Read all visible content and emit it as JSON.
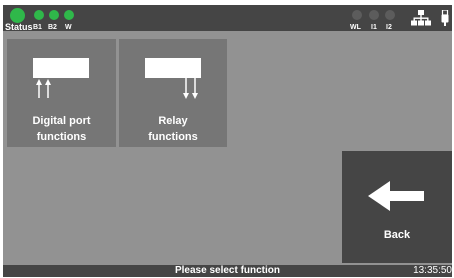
{
  "colors": {
    "led_on": "#2fb84a",
    "led_off": "#5c5c5c",
    "bar": "#454545",
    "screen_bg": "#929292",
    "tile_bg": "#767676"
  },
  "status": {
    "label": "Status",
    "leds": [
      {
        "label": "B1",
        "state": "on"
      },
      {
        "label": "B2",
        "state": "on"
      },
      {
        "label": "W",
        "state": "on"
      }
    ],
    "right_indicators": [
      {
        "label": "WL",
        "state": "off"
      },
      {
        "label": "I1",
        "state": "off"
      },
      {
        "label": "I2",
        "state": "off"
      }
    ],
    "icons": [
      "network-icon",
      "usb-icon"
    ]
  },
  "functions": [
    {
      "line1": "Digital port",
      "line2": "functions",
      "icon": "digital-port-icon"
    },
    {
      "line1": "Relay",
      "line2": "functions",
      "icon": "relay-icon"
    }
  ],
  "back": {
    "label": "Back",
    "icon": "arrow-left-icon"
  },
  "footer": {
    "prompt": "Please select function",
    "time": "13:35:50"
  }
}
